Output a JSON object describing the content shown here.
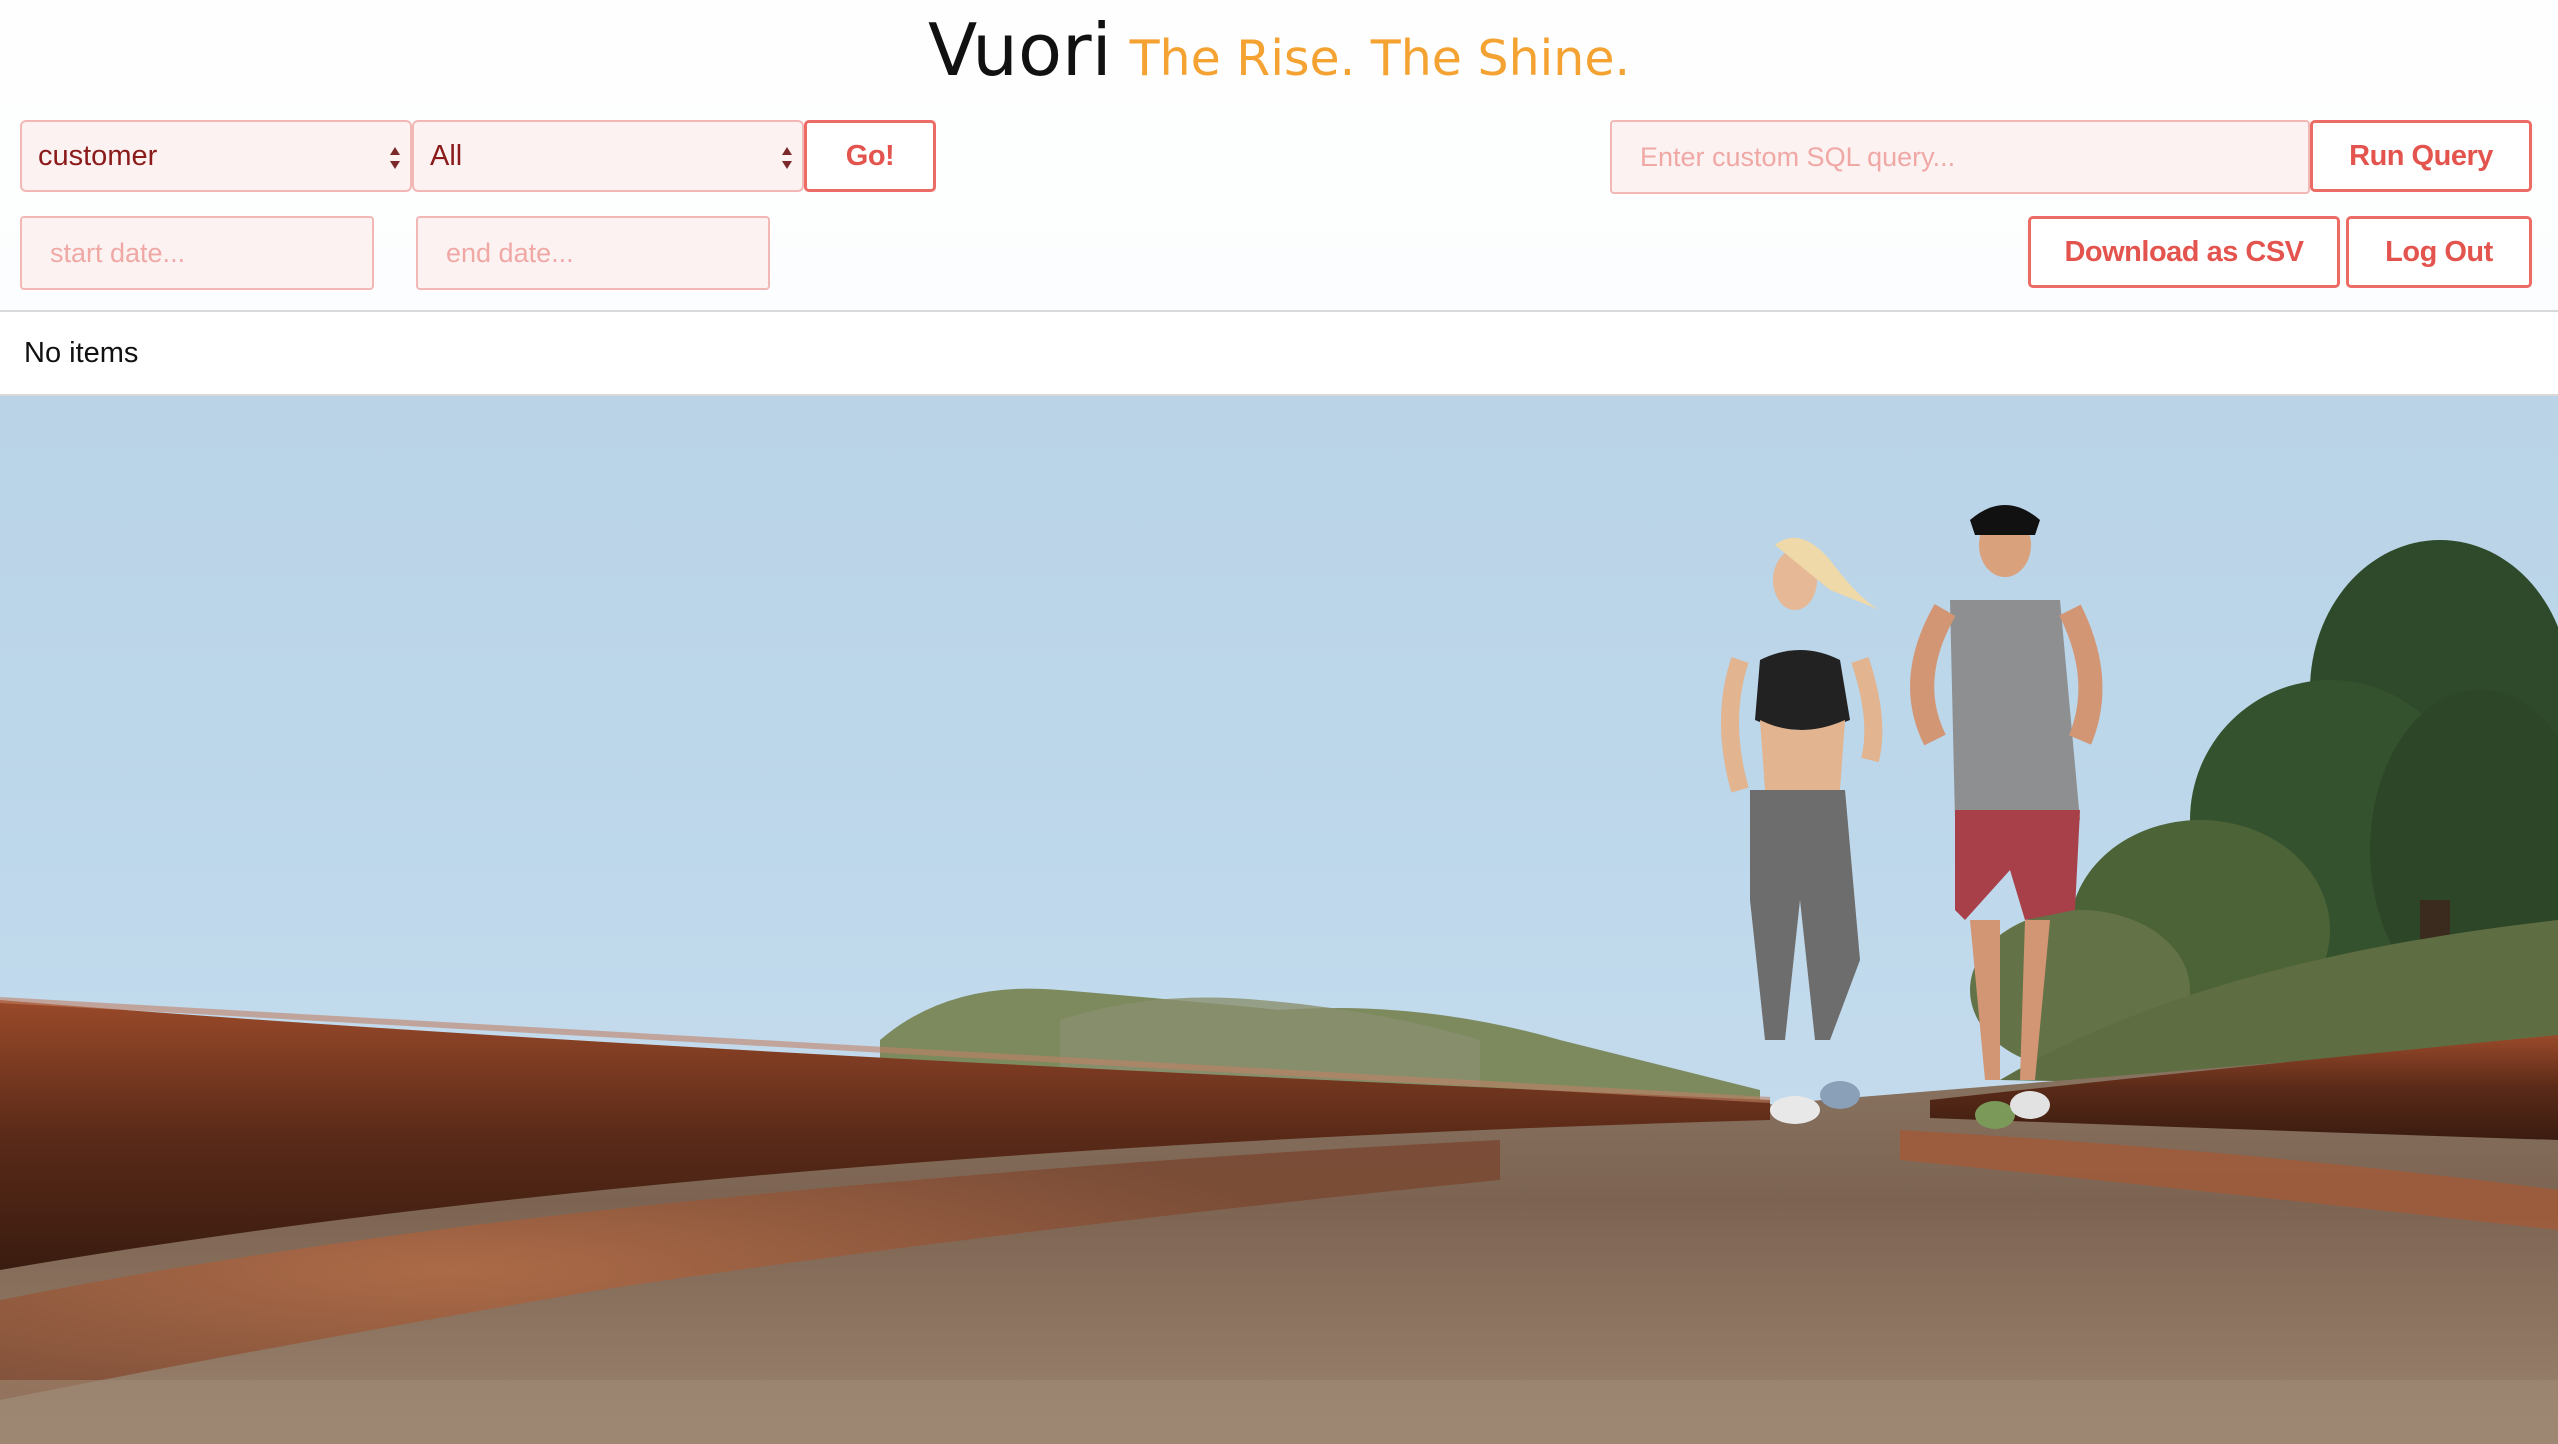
{
  "brand": {
    "name": "Vuori",
    "tagline": "The Rise. The Shine."
  },
  "filters": {
    "entity_select": {
      "selected": "customer"
    },
    "scope_select": {
      "selected": "All"
    },
    "go_label": "Go!",
    "start_date_placeholder": "start date...",
    "end_date_placeholder": "end date..."
  },
  "query": {
    "placeholder": "Enter custom SQL query...",
    "run_label": "Run Query"
  },
  "actions": {
    "download_label": "Download as CSV",
    "logout_label": "Log Out"
  },
  "results": {
    "empty_text": "No items"
  },
  "colors": {
    "accent": "#e4544e",
    "tagline": "#f4a232",
    "input_bg": "#fdf2f2",
    "input_border": "#f2b8b6"
  }
}
